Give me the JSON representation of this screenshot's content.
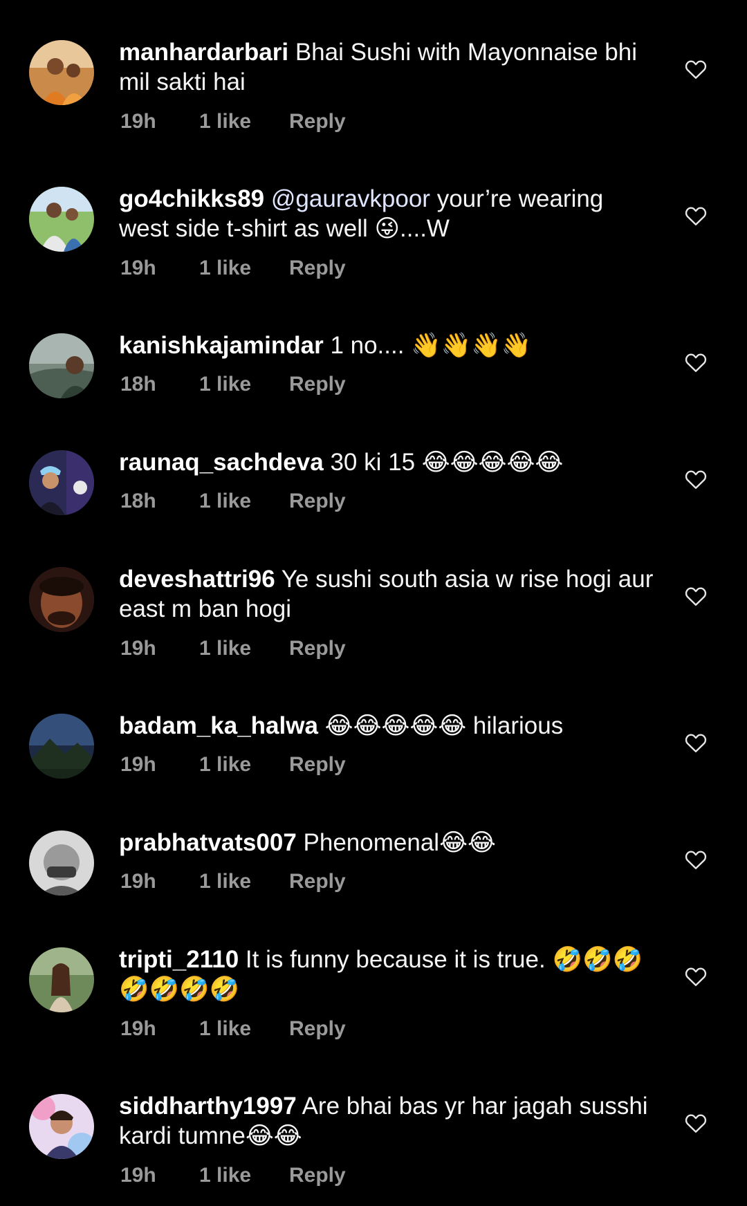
{
  "reply_label": "Reply",
  "colors": {
    "background": "#000000",
    "text": "#f5f5f5",
    "meta": "#9a9a9a",
    "heart_outline": "#e6e6e6"
  },
  "comments": [
    {
      "username": "manhardarbari",
      "text": "Bhai Sushi with Mayonnaise bhi mil sakti hai",
      "time": "19h",
      "likes": "1 like"
    },
    {
      "username": "go4chikks89",
      "mention": "@gauravkpoor",
      "text": "your’re wearing west side t-shirt as well 😜....W",
      "time": "19h",
      "likes": "1 like"
    },
    {
      "username": "kanishkajamindar",
      "text": "1 no.... 👋👋👋👋",
      "time": "18h",
      "likes": "1 like"
    },
    {
      "username": "raunaq_sachdeva",
      "text": "30 ki 15 😂😂😂😂😂",
      "time": "18h",
      "likes": "1 like"
    },
    {
      "username": "deveshattri96",
      "text": "Ye sushi south asia w rise hogi aur east m ban hogi",
      "time": "19h",
      "likes": "1 like"
    },
    {
      "username": "badam_ka_halwa",
      "text": "😂😂😂😂😂 hilarious",
      "time": "19h",
      "likes": "1 like"
    },
    {
      "username": "prabhatvats007",
      "text": "Phenomenal😂😂",
      "time": "19h",
      "likes": "1 like"
    },
    {
      "username": "tripti_2110",
      "text": "It is funny because it is true. 🤣🤣🤣🤣🤣🤣🤣",
      "time": "19h",
      "likes": "1 like"
    },
    {
      "username": "siddharthy1997",
      "text": "Are bhai bas yr har jagah susshi kardi tumne😂😂",
      "time": "19h",
      "likes": "1 like"
    }
  ]
}
